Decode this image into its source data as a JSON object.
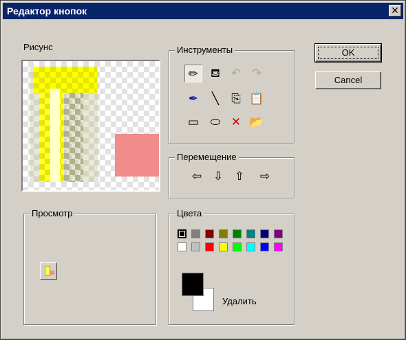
{
  "window": {
    "title": "Редактор кнопок",
    "close_glyph": "✕"
  },
  "picture": {
    "label": "Рисунс"
  },
  "tools": {
    "label": "Инструменты",
    "items": [
      {
        "name": "pencil-icon",
        "glyph": "✏",
        "state": "pressed"
      },
      {
        "name": "fill-bucket-icon",
        "glyph": "⛾",
        "state": "normal"
      },
      {
        "name": "undo-icon",
        "glyph": "↶",
        "state": "disabled"
      },
      {
        "name": "redo-icon",
        "glyph": "↷",
        "state": "disabled"
      },
      {
        "name": "eyedropper-icon",
        "glyph": "✒",
        "state": "normal"
      },
      {
        "name": "line-icon",
        "glyph": "╲",
        "state": "normal"
      },
      {
        "name": "copy-icon",
        "glyph": "⎘",
        "state": "normal"
      },
      {
        "name": "paste-icon",
        "glyph": "📋",
        "state": "normal"
      },
      {
        "name": "rectangle-icon",
        "glyph": "▭",
        "state": "normal"
      },
      {
        "name": "ellipse-icon",
        "glyph": "⬭",
        "state": "normal"
      },
      {
        "name": "clear-icon",
        "glyph": "✕",
        "state": "normal"
      },
      {
        "name": "open-icon",
        "glyph": "📂",
        "state": "normal"
      }
    ]
  },
  "move": {
    "label": "Перемещение",
    "arrows": [
      {
        "name": "move-left-icon",
        "glyph": "⇦"
      },
      {
        "name": "move-down-icon",
        "glyph": "⇩"
      },
      {
        "name": "move-up-icon",
        "glyph": "⇧"
      },
      {
        "name": "move-right-icon",
        "glyph": "⇨"
      }
    ]
  },
  "preview": {
    "label": "Просмотр"
  },
  "colors": {
    "label": "Цвета",
    "palette": [
      "#000000",
      "#808080",
      "#800000",
      "#808000",
      "#008000",
      "#008080",
      "#000080",
      "#800080",
      "#ffffff",
      "#c0c0c0",
      "#ff0000",
      "#ffff00",
      "#00ff00",
      "#00ffff",
      "#0000ff",
      "#ff00ff"
    ],
    "foreground": "#000000",
    "background": "#ffffff",
    "delete_label": "Удалить"
  },
  "buttons": {
    "ok_label": "OK",
    "cancel_label": "Cancel"
  }
}
